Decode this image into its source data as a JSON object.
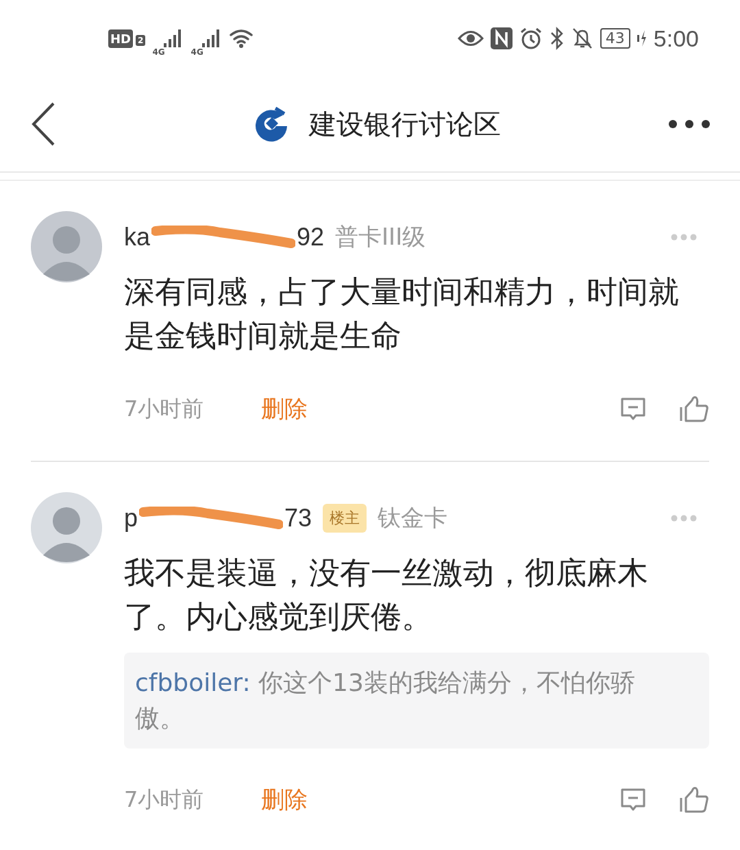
{
  "status_bar": {
    "hd": "HD",
    "sim": "2",
    "network_1": "4G",
    "network_2": "4G",
    "battery": "43",
    "time": "5:00"
  },
  "header": {
    "title": "建设银行讨论区"
  },
  "comments": [
    {
      "name_start": "ka",
      "name_end": "92",
      "card_level": "普卡III级",
      "text": "深有同感，占了大量时间和精力，时间就是金钱时间就是生命",
      "time": "7小时前",
      "delete": "删除"
    },
    {
      "name_start": "p",
      "name_end": "73",
      "owner_badge": "楼主",
      "card_level": "钛金卡",
      "text": "我不是装逼，没有一丝激动，彻底麻木了。内心感觉到厌倦。",
      "replies": [
        {
          "user": "cfbboiler:",
          "text": "你这个13装的我给满分，不怕你骄傲。"
        }
      ],
      "time": "7小时前",
      "delete": "删除"
    }
  ]
}
